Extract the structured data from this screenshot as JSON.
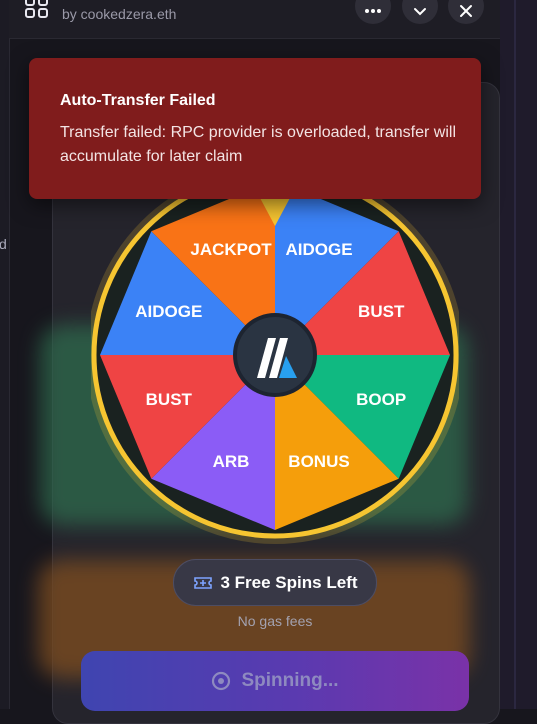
{
  "header": {
    "subtitle": "by cookedzera.eth"
  },
  "sidebar": {
    "partial_char": "d"
  },
  "toast": {
    "title": "Auto-Transfer Failed",
    "message": "Transfer failed: RPC provider is overloaded, transfer will accumulate for later claim"
  },
  "wheel": {
    "segments": [
      "AIDOGE",
      "BUST",
      "BOOP",
      "BONUS",
      "ARB",
      "BUST",
      "AIDOGE",
      "JACKPOT"
    ],
    "colors": [
      "#3b82f6",
      "#ef4444",
      "#10b981",
      "#f59e0b",
      "#8b5cf6",
      "#ef4444",
      "#3b82f6",
      "#f97316"
    ],
    "rim_color": "#f6c531",
    "center_icon": "arbitrum-logo-icon"
  },
  "spins": {
    "label": "3 Free Spins Left",
    "sub": "No gas fees"
  },
  "spin_button": {
    "label": "Spinning..."
  }
}
